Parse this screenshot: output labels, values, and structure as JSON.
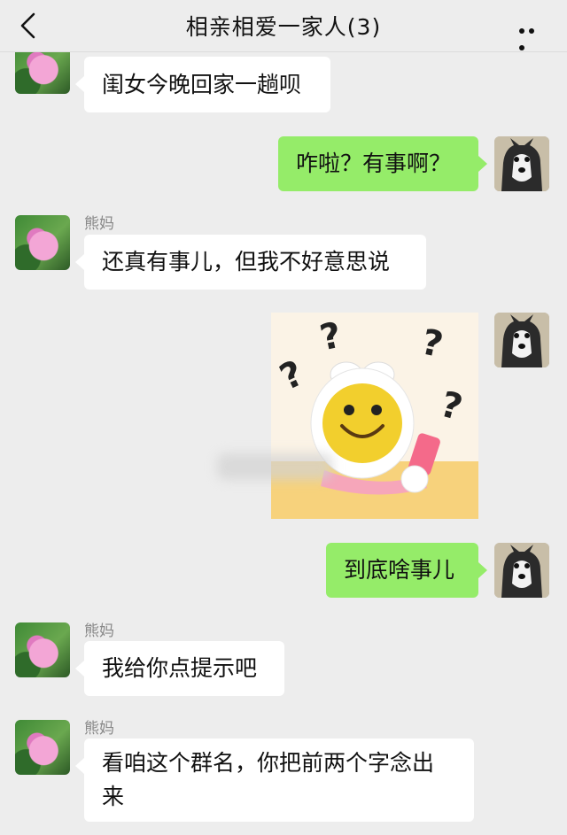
{
  "header": {
    "title": "相亲相爱一家人(3)",
    "back_icon": "chevron-left-icon",
    "more_icon": "ellipsis-icon"
  },
  "messages": [
    {
      "side": "left",
      "sender": "",
      "text": "闺女今晚回家一趟呗"
    },
    {
      "side": "right",
      "sender": "",
      "text": "咋啦？有事啊？"
    },
    {
      "side": "left",
      "sender": "熊妈",
      "text": "还真有事儿，但我不好意思说"
    },
    {
      "side": "right",
      "sender": "",
      "type": "sticker",
      "sticker_icon": "confused-smiley-phone-sticker"
    },
    {
      "side": "right",
      "sender": "",
      "text": "到底啥事儿"
    },
    {
      "side": "left",
      "sender": "熊妈",
      "text": "我给你点提示吧"
    },
    {
      "side": "left",
      "sender": "熊妈",
      "text": "看咱这个群名，你把前两个字念出来"
    }
  ],
  "colors": {
    "background": "#ededed",
    "right_bubble": "#95ec69",
    "left_bubble": "#ffffff"
  }
}
